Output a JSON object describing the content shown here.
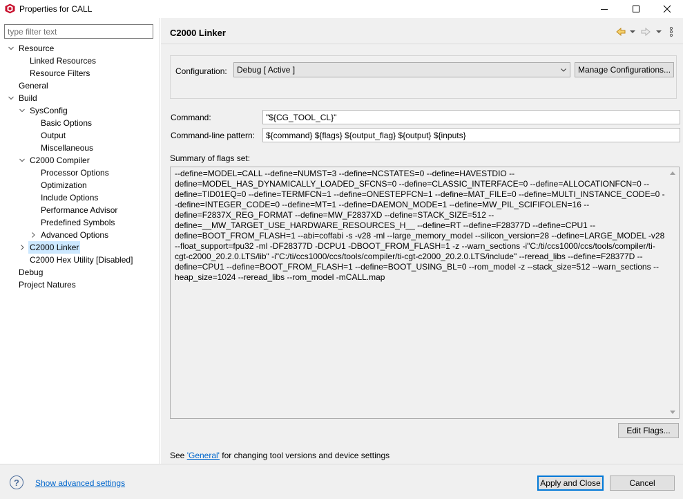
{
  "window": {
    "title": "Properties for CALL",
    "minimize_icon": "minimize-icon",
    "maximize_icon": "maximize-icon",
    "close_icon": "close-icon"
  },
  "sidebar": {
    "filter_placeholder": "type filter text",
    "items": [
      {
        "label": "Resource",
        "level": 0,
        "expanded": true
      },
      {
        "label": "Linked Resources",
        "level": 1
      },
      {
        "label": "Resource Filters",
        "level": 1
      },
      {
        "label": "General",
        "level": 0
      },
      {
        "label": "Build",
        "level": 0,
        "expanded": true
      },
      {
        "label": "SysConfig",
        "level": 1,
        "expanded": true
      },
      {
        "label": "Basic Options",
        "level": 2
      },
      {
        "label": "Output",
        "level": 2
      },
      {
        "label": "Miscellaneous",
        "level": 2
      },
      {
        "label": "C2000 Compiler",
        "level": 1,
        "expanded": true
      },
      {
        "label": "Processor Options",
        "level": 2
      },
      {
        "label": "Optimization",
        "level": 2
      },
      {
        "label": "Include Options",
        "level": 2
      },
      {
        "label": "Performance Advisor",
        "level": 2
      },
      {
        "label": "Predefined Symbols",
        "level": 2
      },
      {
        "label": "Advanced Options",
        "level": 2,
        "expanded": false
      },
      {
        "label": "C2000 Linker",
        "level": 1,
        "expanded": false,
        "selected": true
      },
      {
        "label": "C2000 Hex Utility  [Disabled]",
        "level": 1
      },
      {
        "label": "Debug",
        "level": 0
      },
      {
        "label": "Project Natures",
        "level": 0
      }
    ]
  },
  "page": {
    "title": "C2000 Linker",
    "configuration_label": "Configuration:",
    "configuration_value": "Debug  [ Active ]",
    "manage_configurations": "Manage Configurations...",
    "command_label": "Command:",
    "command_value": "\"${CG_TOOL_CL}\"",
    "pattern_label": "Command-line pattern:",
    "pattern_value": "${command} ${flags} ${output_flag} ${output} ${inputs}",
    "flags_label": "Summary of flags set:",
    "flags_text": "--define=MODEL=CALL --define=NUMST=3 --define=NCSTATES=0 --define=HAVESTDIO --define=MODEL_HAS_DYNAMICALLY_LOADED_SFCNS=0 --define=CLASSIC_INTERFACE=0 --define=ALLOCATIONFCN=0 --define=TID01EQ=0 --define=TERMFCN=1 --define=ONESTEPFCN=1 --define=MAT_FILE=0 --define=MULTI_INSTANCE_CODE=0 --define=INTEGER_CODE=0 --define=MT=1 --define=DAEMON_MODE=1 --define=MW_PIL_SCIFIFOLEN=16 --define=F2837X_REG_FORMAT --define=MW_F2837XD --define=STACK_SIZE=512 --define=__MW_TARGET_USE_HARDWARE_RESOURCES_H__ --define=RT --define=F28377D --define=CPU1 --define=BOOT_FROM_FLASH=1 --abi=coffabi -s -v28 -ml  --large_memory_model --silicon_version=28 --define=LARGE_MODEL -v28 --float_support=fpu32 -ml -DF28377D -DCPU1 -DBOOT_FROM_FLASH=1 -z --warn_sections -i\"C:/ti/ccs1000/ccs/tools/compiler/ti-cgt-c2000_20.2.0.LTS/lib\" -i\"C:/ti/ccs1000/ccs/tools/compiler/ti-cgt-c2000_20.2.0.LTS/include\" --reread_libs --define=F28377D --define=CPU1 --define=BOOT_FROM_FLASH=1 --define=BOOT_USING_BL=0 --rom_model -z  --stack_size=512 --warn_sections --heap_size=1024 --reread_libs --rom_model -mCALL.map",
    "edit_flags": "Edit Flags...",
    "see_prefix": "See ",
    "see_link": "'General'",
    "see_suffix": " for changing tool versions and device settings"
  },
  "footer": {
    "advanced_link": "Show advanced settings",
    "apply_close": "Apply and Close",
    "cancel": "Cancel"
  },
  "colors": {
    "selection": "#cce8ff",
    "link": "#0066cc",
    "default_button_border": "#0078d7"
  }
}
